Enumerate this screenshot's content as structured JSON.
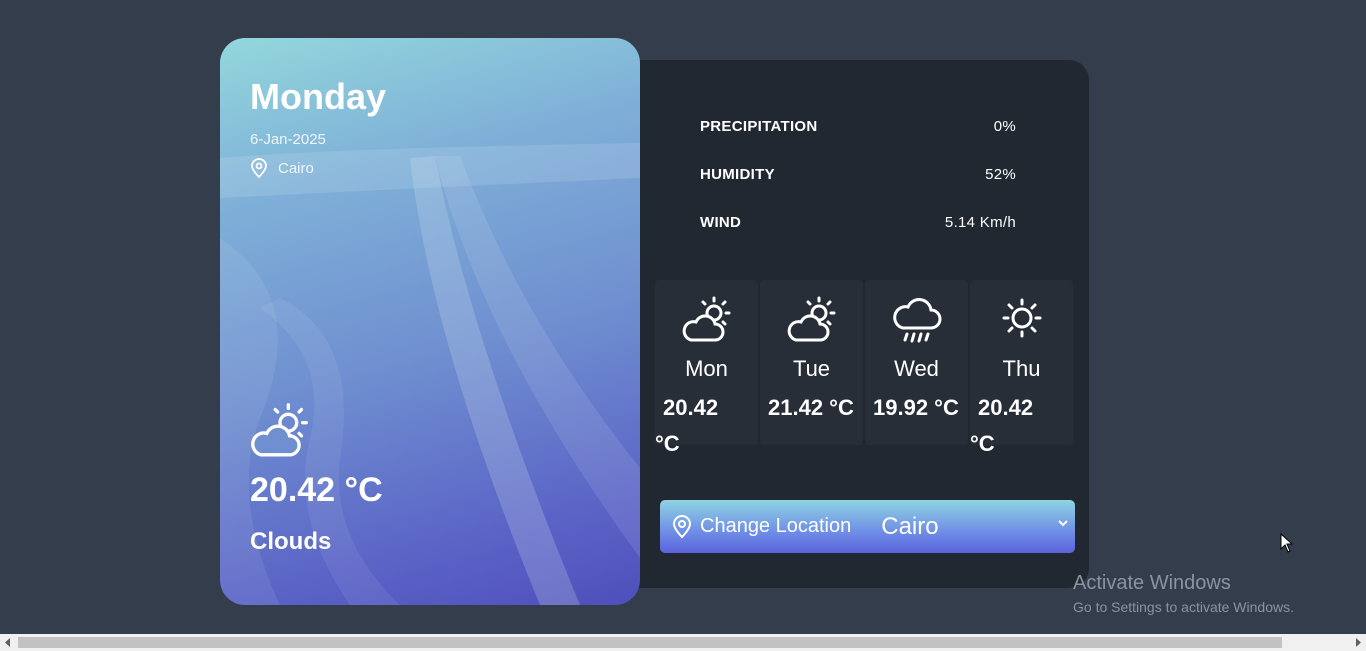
{
  "hero": {
    "day": "Monday",
    "date": "6-Jan-2025",
    "location": "Cairo",
    "temperature": "20.42 °C",
    "condition": "Clouds",
    "icon": "partly-cloudy-icon"
  },
  "stats": [
    {
      "label": "PRECIPITATION",
      "value": "0%"
    },
    {
      "label": "HUMIDITY",
      "value": "52%"
    },
    {
      "label": "WIND",
      "value": "5.14 Km/h"
    }
  ],
  "forecast": [
    {
      "day": "Mon",
      "temp_value": "20.42",
      "temp_unit": "°C",
      "icon": "partly-cloudy-icon"
    },
    {
      "day": "Tue",
      "temp_full": "21.42 °C",
      "icon": "partly-cloudy-icon"
    },
    {
      "day": "Wed",
      "temp_full": "19.92 °C",
      "icon": "rain-icon"
    },
    {
      "day": "Thu",
      "temp_value": "20.42",
      "temp_unit": "°C",
      "icon": "sun-icon"
    }
  ],
  "location_control": {
    "label": "Change Location",
    "selected": "Cairo"
  },
  "watermark": {
    "title": "Activate Windows",
    "subtitle": "Go to Settings to activate Windows."
  },
  "colors": {
    "background": "#343d4b",
    "panel": "#222831",
    "card": "#272e38",
    "accent_start": "#8fd3e2",
    "accent_end": "#5b63de"
  }
}
